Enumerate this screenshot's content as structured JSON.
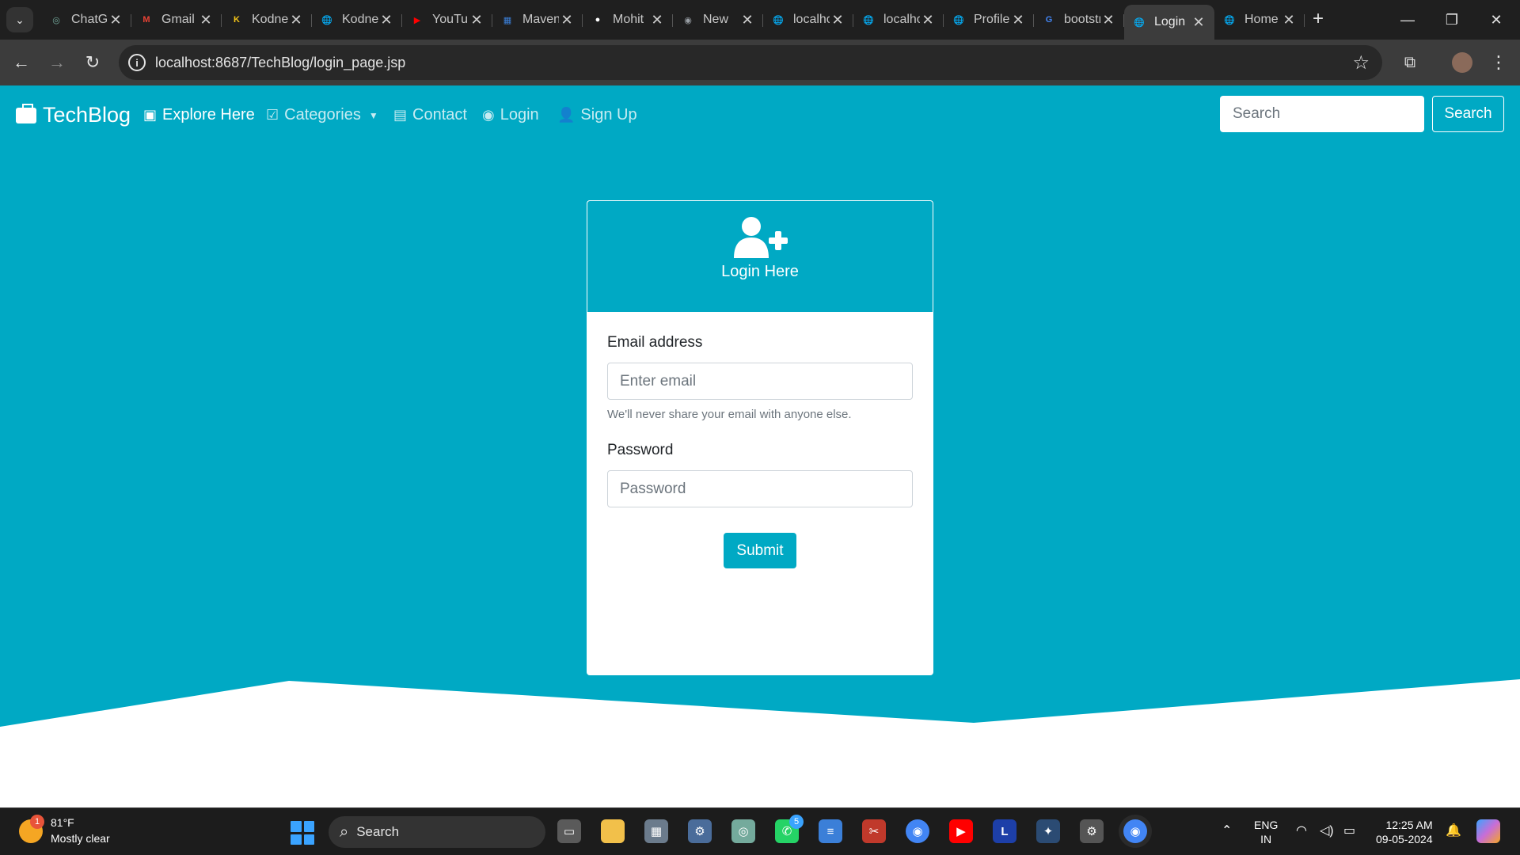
{
  "browser": {
    "tabs": [
      {
        "title": "ChatGPT",
        "icon": "chatgpt-icon",
        "color": "#74aa9c",
        "glyph": "◎"
      },
      {
        "title": "Gmail",
        "icon": "gmail-icon",
        "color": "#ea4335",
        "glyph": "M"
      },
      {
        "title": "Kodnest",
        "icon": "kodnest-icon",
        "color": "#f5c518",
        "glyph": "K"
      },
      {
        "title": "Kodnest",
        "icon": "globe-icon",
        "color": "#9aa0a6",
        "glyph": "🌐"
      },
      {
        "title": "YouTube",
        "icon": "youtube-icon",
        "color": "#ff0000",
        "glyph": "▶"
      },
      {
        "title": "Maven",
        "icon": "maven-icon",
        "color": "#3b7fd8",
        "glyph": "▦"
      },
      {
        "title": "Mohit",
        "icon": "github-icon",
        "color": "#ffffff",
        "glyph": "●"
      },
      {
        "title": "New",
        "icon": "chrome-icon",
        "color": "#9aa0a6",
        "glyph": "◉"
      },
      {
        "title": "localhost",
        "icon": "globe-icon",
        "color": "#9aa0a6",
        "glyph": "🌐"
      },
      {
        "title": "localhost",
        "icon": "globe-icon",
        "color": "#9aa0a6",
        "glyph": "🌐"
      },
      {
        "title": "Profile",
        "icon": "globe-icon",
        "color": "#9aa0a6",
        "glyph": "🌐"
      },
      {
        "title": "bootstrap",
        "icon": "google-icon",
        "color": "#4285f4",
        "glyph": "G"
      },
      {
        "title": "Login",
        "icon": "globe-icon",
        "color": "#9aa0a6",
        "glyph": "🌐",
        "active": true
      },
      {
        "title": "Home",
        "icon": "globe-icon",
        "color": "#9aa0a6",
        "glyph": "🌐"
      }
    ],
    "url": "localhost:8687/TechBlog/login_page.jsp"
  },
  "navbar": {
    "brand": "TechBlog",
    "items": [
      {
        "label": "Explore Here",
        "icon": "play-square-icon",
        "glyph": "▣"
      },
      {
        "label": "Categories",
        "icon": "check-square-icon",
        "glyph": "☑"
      },
      {
        "label": "Contact",
        "icon": "address-book-icon",
        "glyph": "▤"
      },
      {
        "label": "Login",
        "icon": "user-circle-icon",
        "glyph": "◉"
      },
      {
        "label": "Sign Up",
        "icon": "user-plus-icon",
        "glyph": "👤"
      }
    ],
    "search_placeholder": "Search",
    "search_button": "Search"
  },
  "login_card": {
    "title": "Login Here",
    "email_label": "Email address",
    "email_placeholder": "Enter email",
    "email_help": "We'll never share your email with anyone else.",
    "password_label": "Password",
    "password_placeholder": "Password",
    "submit_label": "Submit"
  },
  "colors": {
    "primary": "#00a9c4",
    "chrome_dark": "#1f1f1f",
    "taskbar": "#1c1c1c"
  },
  "taskbar": {
    "weather_temp": "81°F",
    "weather_desc": "Mostly clear",
    "weather_badge": "1",
    "search_label": "Search",
    "whatsapp_badge": "5",
    "lang_top": "ENG",
    "lang_bottom": "IN",
    "time": "12:25 AM",
    "date": "09-05-2024"
  }
}
